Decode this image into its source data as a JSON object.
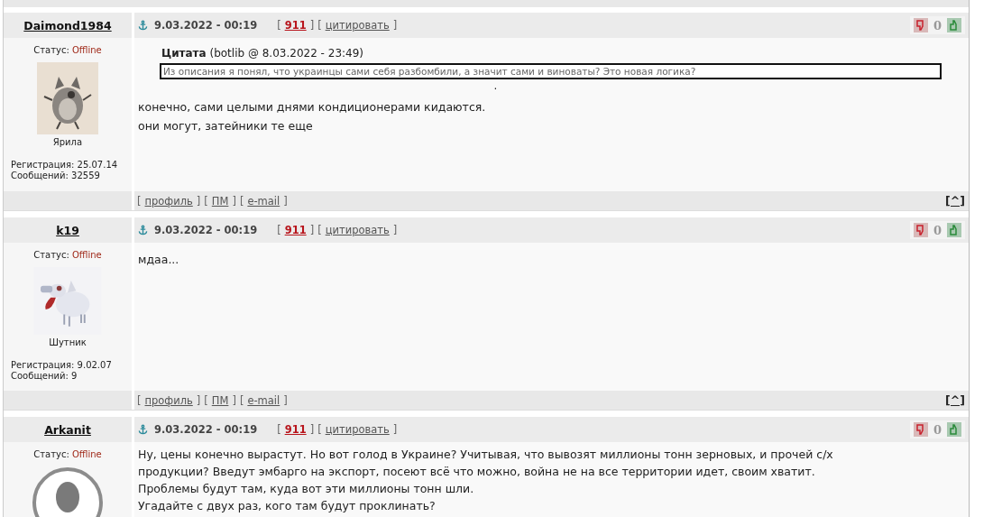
{
  "brackets": [
    "[",
    "]"
  ],
  "posts": [
    {
      "author": "Daimond1984",
      "status_label": "Статус:",
      "status": "Offline",
      "avatar": {
        "kind": "cat"
      },
      "rank": "Ярила",
      "info": [
        "Регистрация: 25.07.14",
        "Сообщений: 32559"
      ],
      "date": "9.03.2022 - 00:19",
      "links": [
        {
          "label": "911",
          "kind": "alert"
        },
        {
          "label": "цитировать",
          "kind": "plain"
        }
      ],
      "rating": "0",
      "quote": {
        "title": "Цитата",
        "source": "(botlib @ 8.03.2022 - 23:49)",
        "text": "Из описания я понял, что украинцы сами себя разбомбили, а значит сами и виноваты? Это новая логика?",
        "after": "."
      },
      "body": [
        "конечно, сами целыми днями кондиционерами кидаются.",
        "они могут, затейники те еще"
      ],
      "footer": [
        "профиль",
        "ПМ",
        "e-mail"
      ],
      "top": "[^]"
    },
    {
      "author": "k19",
      "status_label": "Статус:",
      "status": "Offline",
      "avatar": {
        "kind": "pig"
      },
      "rank": "Шутник",
      "info": [
        "Регистрация: 9.02.07",
        "Сообщений: 9"
      ],
      "date": "9.03.2022 - 00:19",
      "links": [
        {
          "label": "911",
          "kind": "alert"
        },
        {
          "label": "цитировать",
          "kind": "plain"
        }
      ],
      "rating": "0",
      "body": [
        "мдаа..."
      ],
      "footer": [
        "профиль",
        "ПМ",
        "e-mail"
      ],
      "top": "[^]"
    },
    {
      "author": "Arkanit",
      "status_label": "Статус:",
      "status": "Offline",
      "avatar": {
        "kind": "silhouette"
      },
      "date": "9.03.2022 - 00:19",
      "links": [
        {
          "label": "911",
          "kind": "alert"
        },
        {
          "label": "цитировать",
          "kind": "plain"
        }
      ],
      "rating": "0",
      "body": [
        "Ну, цены конечно вырастут. Но вот голод в Украине? Учитывая, что вывозят миллионы тонн зерновых, и прочей с/х",
        "продукции? Введут эмбарго на экспорт, посеют всё что можно, война не на все территории идет, своим хватит.",
        "Проблемы будут там, куда вот эти миллионы тонн шли.",
        "Угадайте с двух раз, кого там будут проклинать?"
      ]
    }
  ]
}
